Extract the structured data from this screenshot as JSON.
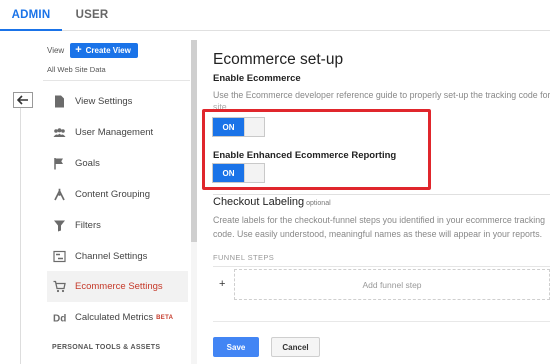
{
  "tabs": [
    {
      "label": "ADMIN"
    },
    {
      "label": "USER"
    }
  ],
  "nav": {
    "view_label": "View",
    "create_view_label": "Create View",
    "view_name": "All Web Site Data",
    "items": [
      {
        "label": "View Settings",
        "icon": "page-icon"
      },
      {
        "label": "User Management",
        "icon": "users-icon"
      },
      {
        "label": "Goals",
        "icon": "flag-icon"
      },
      {
        "label": "Content Grouping",
        "icon": "grouping-icon"
      },
      {
        "label": "Filters",
        "icon": "filter-icon"
      },
      {
        "label": "Channel Settings",
        "icon": "channel-icon"
      },
      {
        "label": "Ecommerce Settings",
        "icon": "cart-icon"
      },
      {
        "label": "Calculated Metrics",
        "icon": "dd-icon",
        "badge": "BETA"
      }
    ],
    "section_head": "PERSONAL TOOLS & ASSETS"
  },
  "main": {
    "title": "Ecommerce set-up",
    "enable_ecommerce": {
      "label": "Enable Ecommerce",
      "helper": "Use the Ecommerce developer reference guide to properly set-up the tracking code for you",
      "helper_cont": "site.",
      "toggle": "ON"
    },
    "enhanced": {
      "label": "Enable Enhanced Ecommerce Reporting",
      "toggle": "ON"
    },
    "checkout": {
      "title": "Checkout Labeling",
      "optional": "optional",
      "desc_line1": "Create labels for the checkout-funnel steps you identified in your ecommerce tracking",
      "desc_line2": "code. Use easily understood, meaningful names as these will appear in your reports."
    },
    "funnel": {
      "label": "FUNNEL STEPS",
      "plus": "+",
      "add_step": "Add funnel step"
    },
    "buttons": {
      "save": "Save",
      "cancel": "Cancel"
    }
  },
  "colors": {
    "accent": "#1a73e8",
    "highlight": "#e0262c",
    "active_text": "#c53929"
  }
}
